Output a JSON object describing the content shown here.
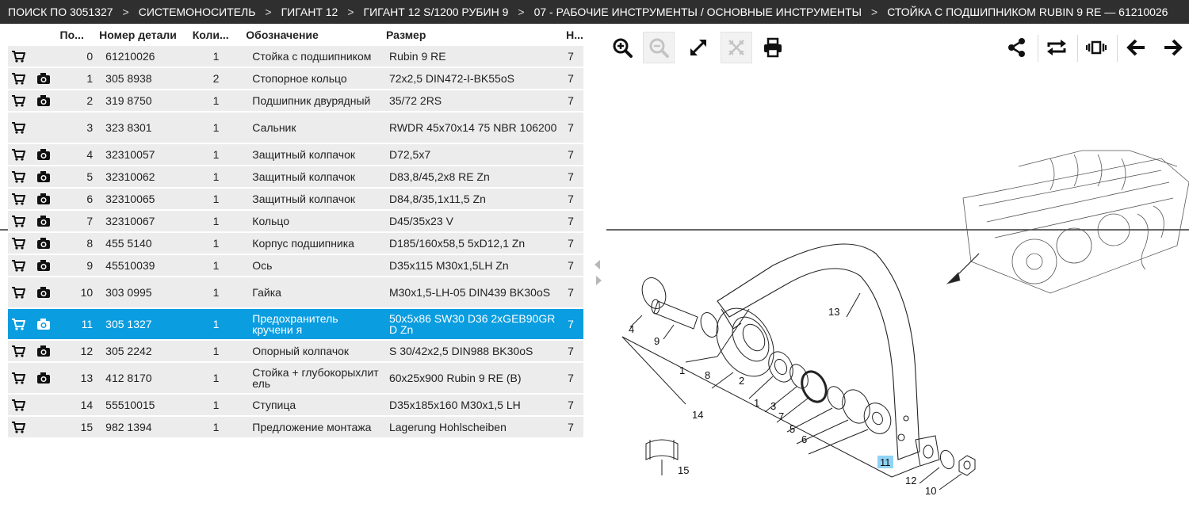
{
  "breadcrumb": [
    "ПОИСК ПО 3051327",
    "СИСТЕМОНОСИТЕЛЬ",
    "ГИГАНТ 12",
    "ГИГАНТ 12 S/1200 РУБИН 9",
    "07 - РАБОЧИЕ ИНСТРУМЕНТЫ / ОСНОВНЫЕ ИНСТРУМЕНТЫ",
    "СТОЙКА С ПОДШИПНИКОМ RUBIN 9 RE — 61210026"
  ],
  "breadcrumb_separator": ">",
  "table": {
    "headers": {
      "pos": "По...",
      "part_number": "Номер детали",
      "qty": "Коли...",
      "designation": "Обозначение",
      "size": "Размер",
      "extra": "Н..."
    },
    "rows": [
      {
        "pos": "0",
        "part": "61210026",
        "qty": "1",
        "name": "Стойка с подшипником",
        "size": "Rubin 9 RE",
        "extra": "7",
        "photo": false,
        "selected": false
      },
      {
        "pos": "1",
        "part": "305 8938",
        "qty": "2",
        "name": "Стопорное кольцо",
        "size": "72x2,5 DIN472-I-BK55oS",
        "extra": "7",
        "photo": true,
        "selected": false
      },
      {
        "pos": "2",
        "part": "319 8750",
        "qty": "1",
        "name": "Подшипник двурядный",
        "size": "35/72 2RS",
        "extra": "7",
        "photo": true,
        "selected": false
      },
      {
        "pos": "3",
        "part": "323 8301",
        "qty": "1",
        "name": "Сальник",
        "size": "RWDR 45x70x14 75 NBR 106200",
        "extra": "7",
        "photo": false,
        "selected": false
      },
      {
        "pos": "4",
        "part": "32310057",
        "qty": "1",
        "name": "Защитный колпачок",
        "size": "D72,5x7",
        "extra": "7",
        "photo": true,
        "selected": false
      },
      {
        "pos": "5",
        "part": "32310062",
        "qty": "1",
        "name": "Защитный колпачок",
        "size": "D83,8/45,2x8 RE Zn",
        "extra": "7",
        "photo": true,
        "selected": false
      },
      {
        "pos": "6",
        "part": "32310065",
        "qty": "1",
        "name": "Защитный колпачок",
        "size": "D84,8/35,1x11,5 Zn",
        "extra": "7",
        "photo": true,
        "selected": false
      },
      {
        "pos": "7",
        "part": "32310067",
        "qty": "1",
        "name": "Кольцо",
        "size": "D45/35x23 V",
        "extra": "7",
        "photo": true,
        "selected": false
      },
      {
        "pos": "8",
        "part": "455 5140",
        "qty": "1",
        "name": "Корпус подшипника",
        "size": "D185/160x58,5 5xD12,1 Zn",
        "extra": "7",
        "photo": true,
        "selected": false
      },
      {
        "pos": "9",
        "part": "45510039",
        "qty": "1",
        "name": "Ось",
        "size": "D35x115 M30x1,5LH Zn",
        "extra": "7",
        "photo": true,
        "selected": false
      },
      {
        "pos": "10",
        "part": "303 0995",
        "qty": "1",
        "name": "Гайка",
        "size": "M30x1,5-LH-05 DIN439 BK30oS",
        "extra": "7",
        "photo": true,
        "selected": false
      },
      {
        "pos": "11",
        "part": "305 1327",
        "qty": "1",
        "name": "Предохранитель кручени я",
        "size": "50x5x86 SW30 D36 2xGEB90GR D Zn",
        "extra": "7",
        "photo": true,
        "selected": true
      },
      {
        "pos": "12",
        "part": "305 2242",
        "qty": "1",
        "name": "Опорный колпачок",
        "size": "S 30/42x2,5 DIN988 BK30oS",
        "extra": "7",
        "photo": true,
        "selected": false
      },
      {
        "pos": "13",
        "part": "412 8170",
        "qty": "1",
        "name": "Стойка + глубокорыхлит ель",
        "size": "60x25x900 Rubin 9 RE (B)",
        "extra": "7",
        "photo": true,
        "selected": false
      },
      {
        "pos": "14",
        "part": "55510015",
        "qty": "1",
        "name": "Ступица",
        "size": "D35x185x160 M30x1,5 LH",
        "extra": "7",
        "photo": false,
        "selected": false
      },
      {
        "pos": "15",
        "part": "982 1394",
        "qty": "1",
        "name": "Предложение монтажа",
        "size": "Lagerung Hohlscheiben",
        "extra": "7",
        "photo": false,
        "selected": false
      }
    ]
  },
  "toolbar": {
    "zoom_in": "zoom-in-icon",
    "zoom_out": "zoom-out-icon",
    "fullscreen": "expand-icon",
    "fit": "fit-icon",
    "print": "print-icon",
    "share": "share-icon",
    "rotate": "rotate-icon",
    "gallery": "gallery-icon",
    "prev": "arrow-left-icon",
    "next": "arrow-right-icon"
  },
  "diagram": {
    "callouts": [
      "1",
      "1",
      "2",
      "3",
      "4",
      "5",
      "6",
      "7",
      "8",
      "9",
      "10",
      "11",
      "12",
      "13",
      "14",
      "15"
    ],
    "highlighted": "11",
    "highlight_color": "#8fd3f5"
  },
  "colors": {
    "header_bg": "#2f2f2f",
    "row_bg": "#ececec",
    "selected_bg": "#0a9de0"
  }
}
